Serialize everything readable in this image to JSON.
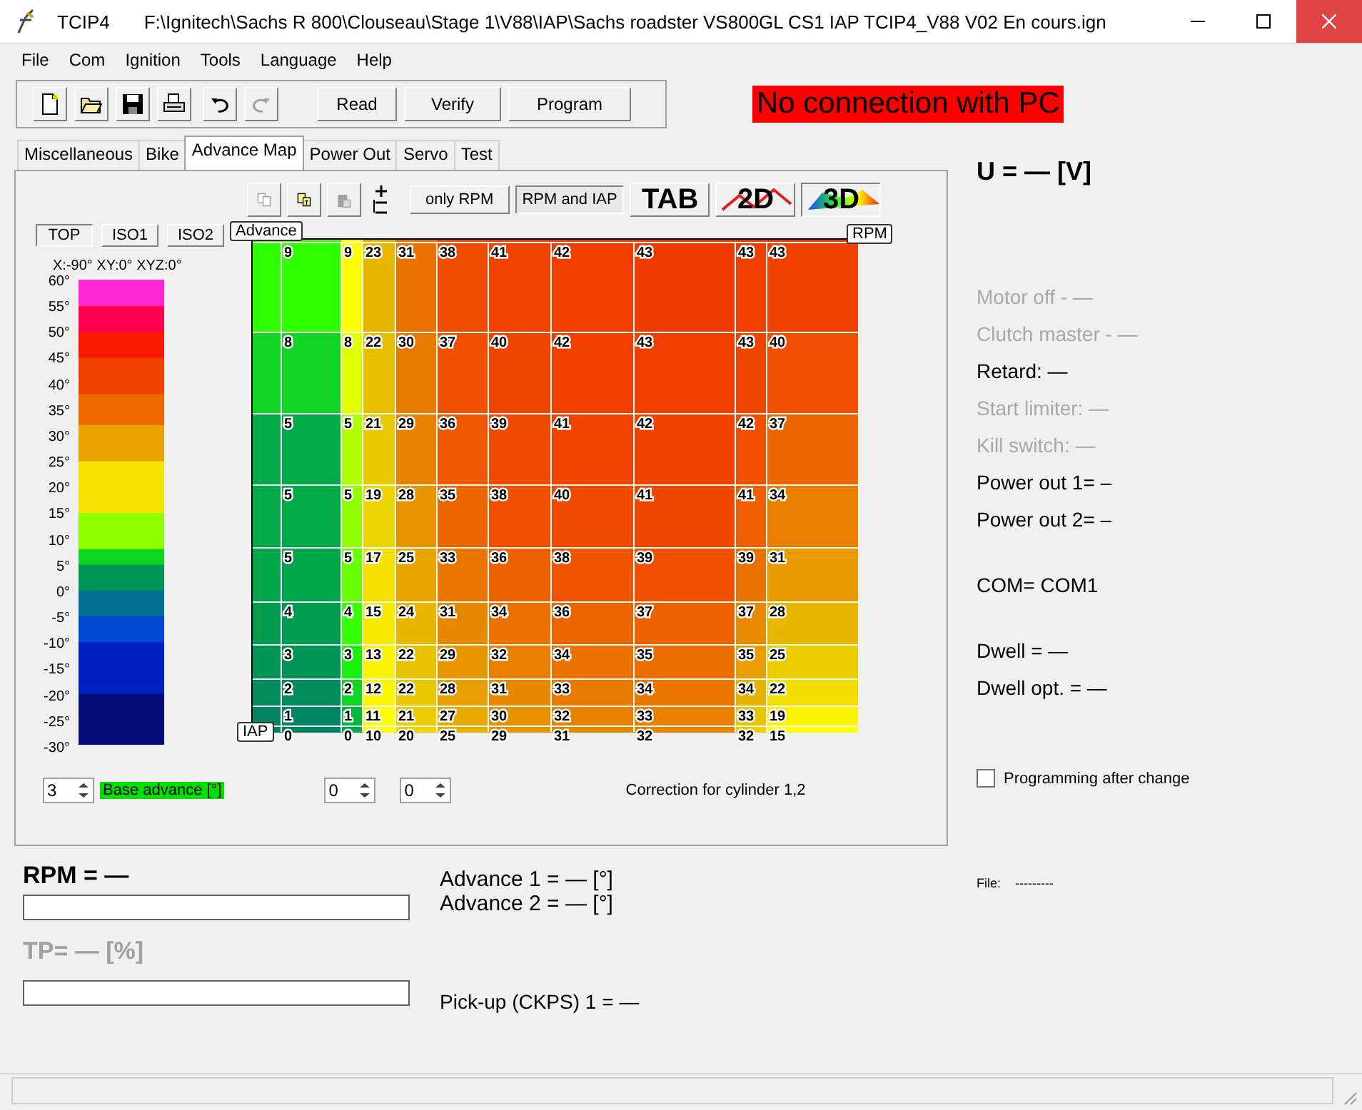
{
  "window": {
    "title": "TCIP4",
    "path": "F:\\Ignitech\\Sachs R 800\\Clouseau\\Stage 1\\V88\\IAP\\Sachs roadster VS800GL CS1 IAP TCIP4_V88 V02 En cours.ign"
  },
  "menu": [
    "File",
    "Com",
    "Ignition",
    "Tools",
    "Language",
    "Help"
  ],
  "toolbar": {
    "icons": [
      {
        "kind": "new",
        "disabled": false
      },
      {
        "kind": "open",
        "disabled": false
      },
      {
        "kind": "save",
        "disabled": false
      },
      {
        "kind": "print",
        "disabled": false
      },
      {
        "kind": "undo",
        "disabled": false
      },
      {
        "kind": "redo",
        "disabled": true
      }
    ],
    "buttons": [
      "Read",
      "Verify",
      "Program"
    ]
  },
  "connection_status": "No connection with PC",
  "tabs": [
    {
      "label": "Miscellaneous",
      "selected": false
    },
    {
      "label": "Bike",
      "selected": false
    },
    {
      "label": "Advance Map",
      "selected": true
    },
    {
      "label": "Power Out",
      "selected": false
    },
    {
      "label": "Servo",
      "selected": false
    },
    {
      "label": "Test",
      "selected": false
    }
  ],
  "map_toolbar": {
    "icons": [
      {
        "kind": "copy",
        "disabled": true
      },
      {
        "kind": "paste-special",
        "disabled": false
      },
      {
        "kind": "paste",
        "disabled": true
      },
      {
        "kind": "plus-minus",
        "disabled": false
      }
    ],
    "modes": [
      {
        "label": "only RPM",
        "selected": false
      },
      {
        "label": "RPM and IAP",
        "selected": true
      }
    ],
    "views": [
      {
        "label": "TAB",
        "kind": "text",
        "selected": false
      },
      {
        "label": "2D",
        "kind": "line",
        "selected": false
      },
      {
        "label": "3D",
        "kind": "surface",
        "selected": true
      }
    ]
  },
  "projections": [
    {
      "label": "TOP",
      "selected": true
    },
    {
      "label": "ISO1",
      "selected": false
    },
    {
      "label": "ISO2",
      "selected": false
    }
  ],
  "rotation": "X:-90°  XY:0°  XYZ:0°",
  "legend_ticks": [
    "60°",
    "55°",
    "50°",
    "45°",
    "40°",
    "35°",
    "30°",
    "25°",
    "20°",
    "15°",
    "10°",
    "5°",
    "0°",
    "-5°",
    "-10°",
    "-15°",
    "-20°",
    "-25°",
    "-30°"
  ],
  "map": {
    "z_label": "Advance",
    "x_label": "RPM",
    "y_label": "IAP",
    "rows": [
      [
        "9",
        "9",
        "23",
        "31",
        "38",
        "41",
        "42",
        "43",
        "43",
        "43"
      ],
      [
        "8",
        "8",
        "22",
        "30",
        "37",
        "40",
        "42",
        "43",
        "43",
        "40"
      ],
      [
        "5",
        "5",
        "21",
        "29",
        "36",
        "39",
        "41",
        "42",
        "42",
        "37"
      ],
      [
        "5",
        "5",
        "19",
        "28",
        "35",
        "38",
        "40",
        "41",
        "41",
        "34"
      ],
      [
        "5",
        "5",
        "17",
        "25",
        "33",
        "36",
        "38",
        "39",
        "39",
        "31"
      ],
      [
        "4",
        "4",
        "15",
        "24",
        "31",
        "34",
        "36",
        "37",
        "37",
        "28"
      ],
      [
        "3",
        "3",
        "13",
        "22",
        "29",
        "32",
        "34",
        "35",
        "35",
        "25"
      ],
      [
        "2",
        "2",
        "12",
        "22",
        "28",
        "31",
        "33",
        "34",
        "34",
        "22"
      ],
      [
        "1",
        "1",
        "11",
        "21",
        "27",
        "30",
        "32",
        "33",
        "33",
        "19"
      ],
      [
        "0",
        "0",
        "10",
        "20",
        "25",
        "29",
        "31",
        "32",
        "32",
        "15"
      ]
    ]
  },
  "spinners": [
    {
      "value": "3",
      "label": "Base advance [°]"
    },
    {
      "value": "0"
    },
    {
      "value": "0"
    }
  ],
  "correction_label": "Correction for cylinder 1,2",
  "readouts": {
    "rpm": "RPM = —",
    "tp": "TP= — [%]",
    "tp_disabled": true,
    "advance_1": "Advance 1 = — [°]",
    "advance_2": "Advance 2 = — [°]",
    "pickup": "Pick-up (CKPS) 1 = —"
  },
  "voltage": "U = — [V]",
  "status_groups": [
    [
      {
        "text": "Motor off - —",
        "disabled": true
      },
      {
        "text": "Clutch master - —",
        "disabled": true
      },
      {
        "text": "Retard: —",
        "disabled": false
      },
      {
        "text": "Start limiter: —",
        "disabled": true
      },
      {
        "text": "Kill switch: —",
        "disabled": true
      },
      {
        "text": "Power out 1= –",
        "disabled": false
      },
      {
        "text": "Power out 2= –",
        "disabled": false
      }
    ],
    [
      {
        "text": "COM= COM1",
        "disabled": false
      }
    ],
    [
      {
        "text": "Dwell = —",
        "disabled": false
      },
      {
        "text": "Dwell opt. = —",
        "disabled": false
      }
    ]
  ],
  "programming_after_change": {
    "label": "Programming after change",
    "checked": false
  },
  "file": {
    "label": "File:",
    "value": "---------"
  }
}
